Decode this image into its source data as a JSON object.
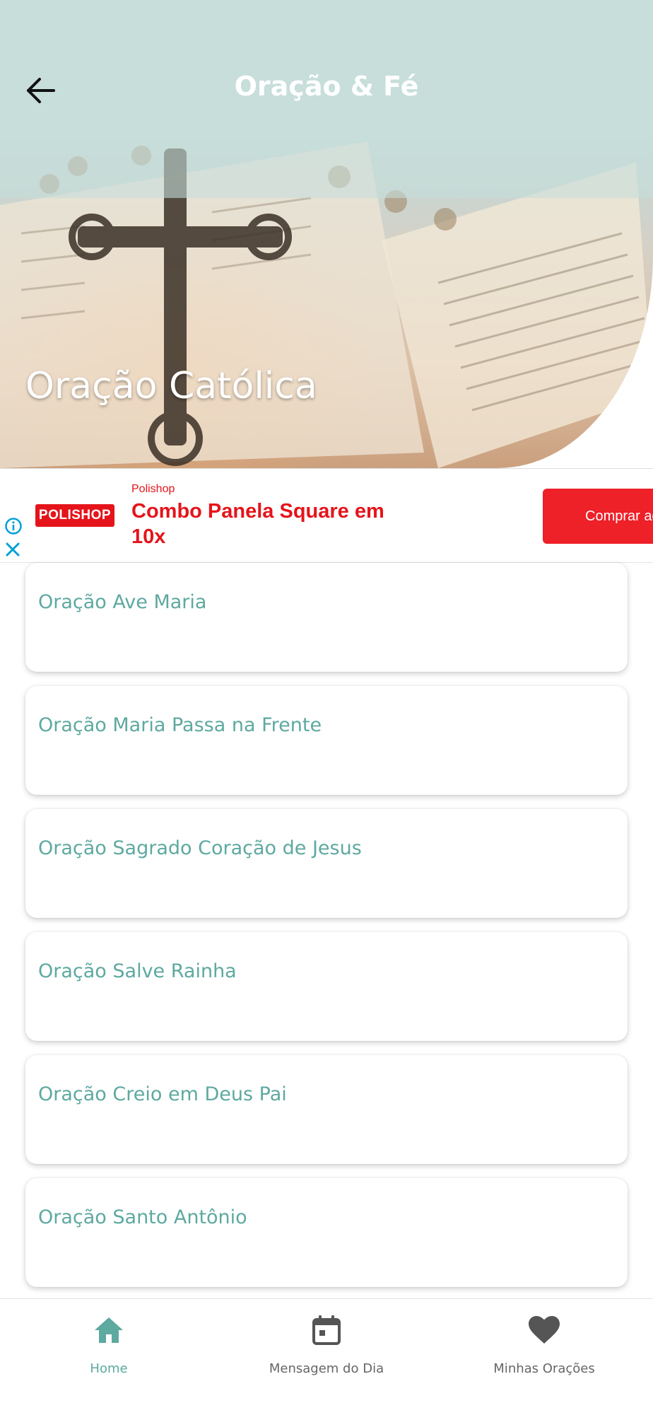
{
  "header": {
    "app_title": "Oração & Fé",
    "back_icon": "arrow-left-icon"
  },
  "hero": {
    "title": "Oração Católica",
    "image_icon": "rosary-bible-image"
  },
  "ad": {
    "brand_logo": "POLISHOP",
    "brand_name": "Polishop",
    "headline": "Combo Panela Square em 10x",
    "cta_label": "Comprar ag",
    "info_icon": "info-icon",
    "close_icon": "close-icon",
    "brand_color": "#e5141b"
  },
  "prayers": [
    {
      "title": "Oração Ave Maria"
    },
    {
      "title": "Oração Maria Passa na Frente"
    },
    {
      "title": "Oração Sagrado Coração de Jesus"
    },
    {
      "title": "Oração Salve Rainha"
    },
    {
      "title": "Oração Creio em Deus Pai"
    },
    {
      "title": "Oração Santo Antônio"
    }
  ],
  "bottom_nav": {
    "items": [
      {
        "label": "Home",
        "icon": "home-icon",
        "active": true
      },
      {
        "label": "Mensagem do Dia",
        "icon": "calendar-icon",
        "active": false
      },
      {
        "label": "Minhas Orações",
        "icon": "heart-icon",
        "active": false
      }
    ]
  },
  "colors": {
    "accent": "#5ea9a0",
    "header_bg": "#c7dedb",
    "nav_inactive": "#666666"
  }
}
